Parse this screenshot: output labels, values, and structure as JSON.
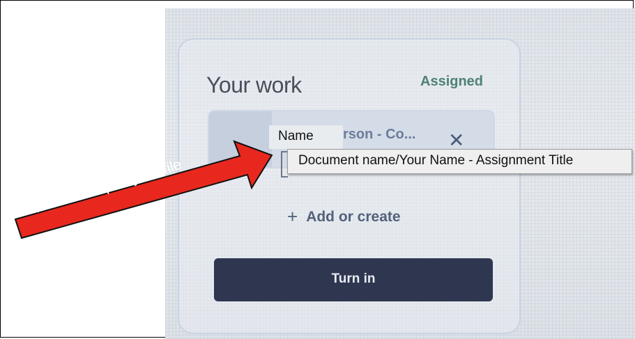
{
  "card": {
    "title": "Your work",
    "status": "Assigned",
    "attachment_name": "rson - Co...",
    "remove_symbol": "✕"
  },
  "annotation": {
    "name_label": "Name",
    "tooltip": "Document name/Your Name - Assignment Title",
    "arrow_label": "4. Click to open your file",
    "arrow_color": "#e8281e"
  },
  "actions": {
    "add_or_create": "Add or create",
    "turn_in": "Turn in"
  }
}
